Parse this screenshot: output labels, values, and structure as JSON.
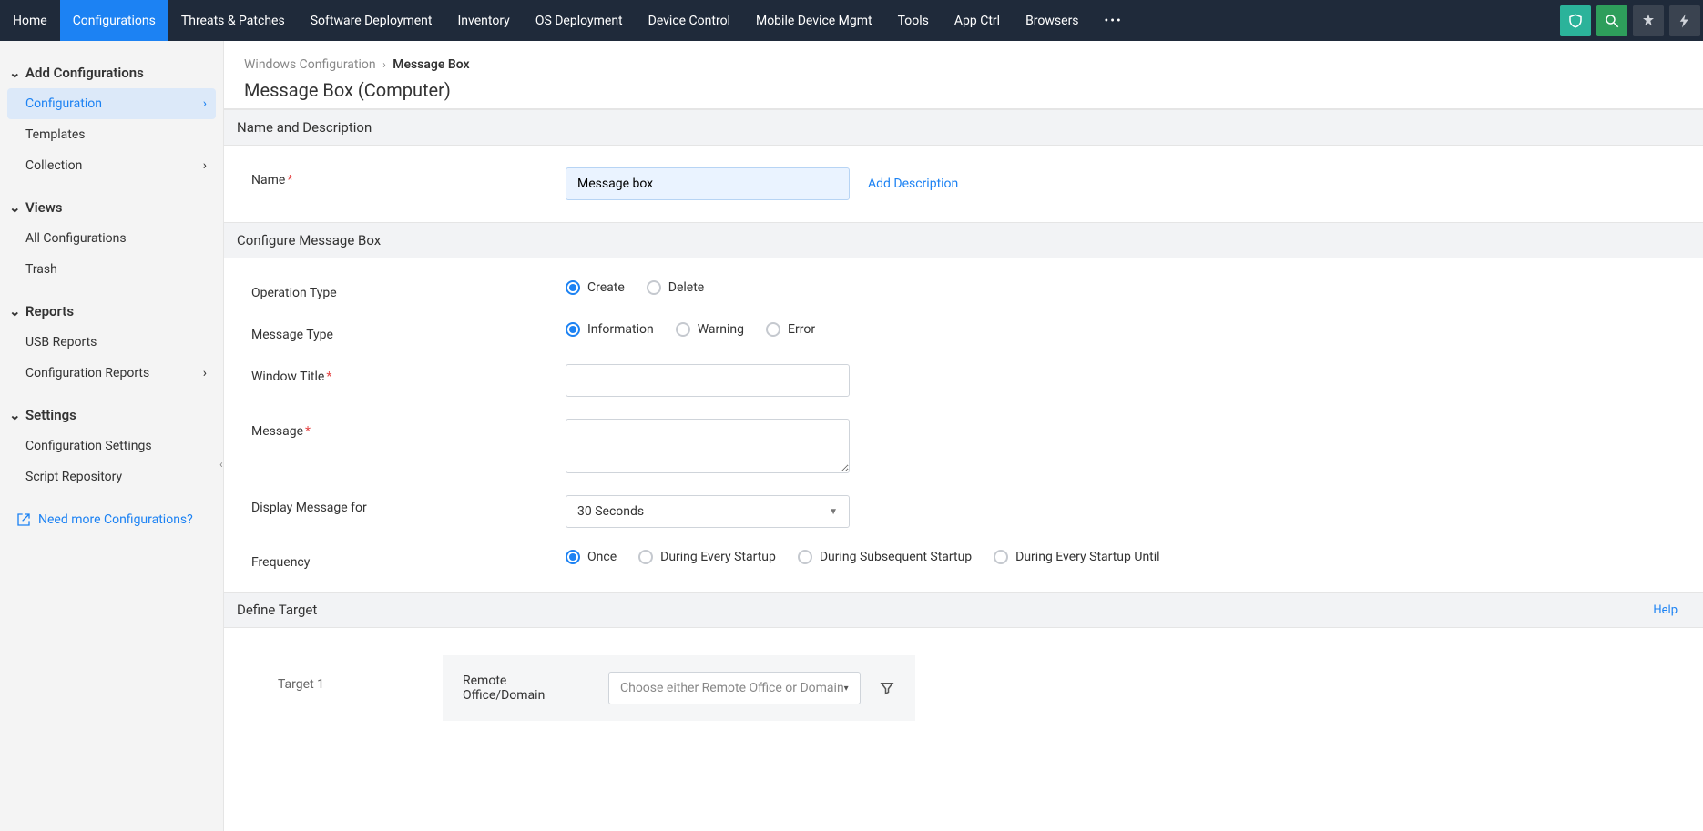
{
  "topnav": {
    "items": [
      "Home",
      "Configurations",
      "Threats & Patches",
      "Software Deployment",
      "Inventory",
      "OS Deployment",
      "Device Control",
      "Mobile Device Mgmt",
      "Tools",
      "App Ctrl",
      "Browsers"
    ],
    "activeIndex": 1
  },
  "sidebar": {
    "groups": [
      {
        "title": "Add Configurations",
        "items": [
          {
            "label": "Configuration",
            "active": true,
            "arrow": true
          },
          {
            "label": "Templates"
          },
          {
            "label": "Collection",
            "arrow": true
          }
        ]
      },
      {
        "title": "Views",
        "items": [
          {
            "label": "All Configurations"
          },
          {
            "label": "Trash"
          }
        ]
      },
      {
        "title": "Reports",
        "items": [
          {
            "label": "USB Reports"
          },
          {
            "label": "Configuration Reports",
            "arrow": true
          }
        ]
      },
      {
        "title": "Settings",
        "items": [
          {
            "label": "Configuration Settings"
          },
          {
            "label": "Script Repository"
          }
        ]
      }
    ],
    "needMore": "Need more Configurations?"
  },
  "breadcrumb": {
    "parent": "Windows Configuration",
    "current": "Message Box"
  },
  "page": {
    "title": "Message Box (Computer)"
  },
  "sections": {
    "nameDesc": {
      "title": "Name and Description",
      "nameLabel": "Name",
      "nameValue": "Message box",
      "addDesc": "Add Description"
    },
    "configure": {
      "title": "Configure Message Box",
      "opType": {
        "label": "Operation Type",
        "options": [
          "Create",
          "Delete"
        ],
        "selected": 0
      },
      "msgType": {
        "label": "Message Type",
        "options": [
          "Information",
          "Warning",
          "Error"
        ],
        "selected": 0
      },
      "winTitle": {
        "label": "Window Title",
        "value": ""
      },
      "message": {
        "label": "Message",
        "value": ""
      },
      "display": {
        "label": "Display Message for",
        "value": "30 Seconds"
      },
      "frequency": {
        "label": "Frequency",
        "options": [
          "Once",
          "During Every Startup",
          "During Subsequent Startup",
          "During Every Startup Until"
        ],
        "selected": 0
      }
    },
    "target": {
      "title": "Define Target",
      "help": "Help",
      "row": {
        "outerLabel": "Target 1",
        "innerLabel": "Remote Office/Domain",
        "placeholder": "Choose either Remote Office or Domain"
      }
    }
  }
}
